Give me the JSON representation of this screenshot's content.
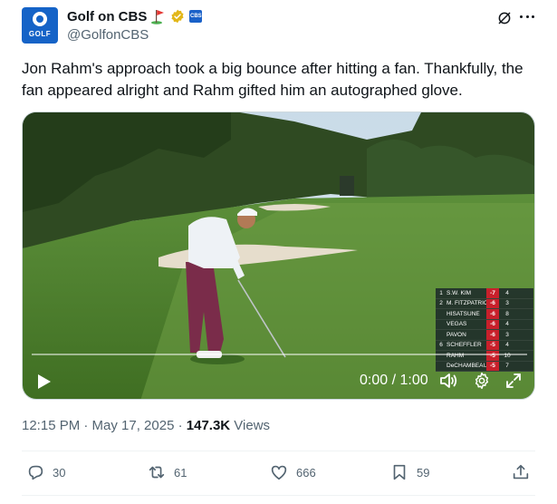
{
  "account": {
    "display_name": "Golf on CBS",
    "display_emoji": "⛳",
    "handle": "@GolfonCBS",
    "avatar_text": "GOLF",
    "affiliate_badge_text": "CBS"
  },
  "tweet": {
    "text": "Jon Rahm's approach took a big bounce after hitting a fan. Thankfully, the fan appeared alright and Rahm gifted him an autographed glove."
  },
  "video": {
    "time": "0:00 / 1:00",
    "progress": 0.0,
    "leaderboard": [
      {
        "pos": "1",
        "name": "S.W. KIM",
        "score": "-7",
        "thru": "4"
      },
      {
        "pos": "2",
        "name": "M. FITZPATRICK",
        "score": "-6",
        "thru": "3"
      },
      {
        "pos": "",
        "name": "HISATSUNE",
        "score": "-6",
        "thru": "8"
      },
      {
        "pos": "",
        "name": "VEGAS",
        "score": "-6",
        "thru": "4"
      },
      {
        "pos": "",
        "name": "PAVON",
        "score": "-6",
        "thru": "3"
      },
      {
        "pos": "6",
        "name": "SCHEFFLER",
        "score": "-5",
        "thru": "4"
      },
      {
        "pos": "",
        "name": "RAHM",
        "score": "-5",
        "thru": "10"
      },
      {
        "pos": "",
        "name": "DeCHAMBEAU",
        "score": "-5",
        "thru": "7"
      }
    ]
  },
  "meta": {
    "timestamp": "12:15 PM · May 17, 2025 · ",
    "views_count": "147.3K",
    "views_label": " Views"
  },
  "actions": {
    "replies": "30",
    "reposts": "61",
    "likes": "666",
    "bookmarks": "59"
  },
  "colors": {
    "accent": "#1d9bf0",
    "text_primary": "#0f1419",
    "text_secondary": "#536471",
    "leaderboard_score_bg": "#c8202b",
    "verified_gold": "#e2b719"
  }
}
